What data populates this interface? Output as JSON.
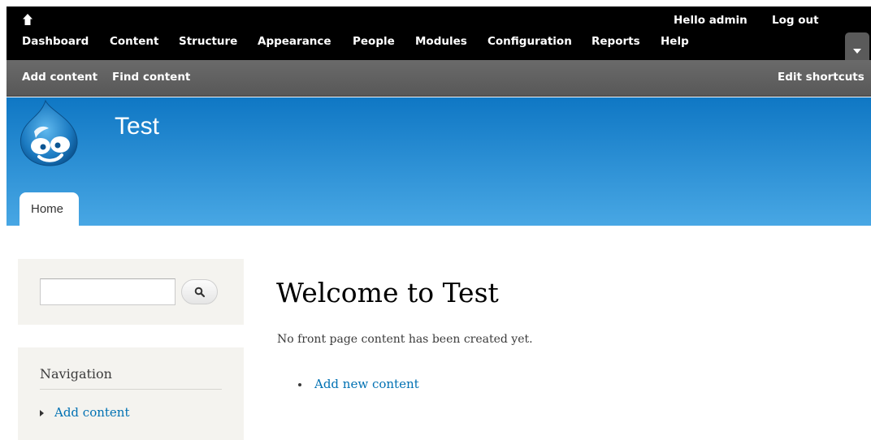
{
  "toolbar": {
    "home_icon": "home-icon",
    "menu": [
      {
        "label": "Dashboard"
      },
      {
        "label": "Content"
      },
      {
        "label": "Structure"
      },
      {
        "label": "Appearance"
      },
      {
        "label": "People"
      },
      {
        "label": "Modules"
      },
      {
        "label": "Configuration"
      },
      {
        "label": "Reports"
      },
      {
        "label": "Help"
      }
    ],
    "greeting": "Hello",
    "username": "admin",
    "logout_label": "Log out",
    "drawer_icon": "caret-down-icon"
  },
  "shortcuts": {
    "items": [
      {
        "label": "Add content"
      },
      {
        "label": "Find content"
      }
    ],
    "edit_label": "Edit shortcuts"
  },
  "header": {
    "logo_icon": "drupal-drop-logo",
    "site_name": "Test",
    "tabs": [
      {
        "label": "Home"
      }
    ]
  },
  "sidebar": {
    "search": {
      "value": "",
      "placeholder": "",
      "button_icon": "search-icon"
    },
    "navigation": {
      "title": "Navigation",
      "items": [
        {
          "label": "Add content"
        }
      ]
    }
  },
  "main": {
    "title": "Welcome to Test",
    "message": "No front page content has been created yet.",
    "links": [
      {
        "label": "Add new content"
      }
    ]
  },
  "colors": {
    "toolbar_bg": "#000000",
    "shortcuts_bg": "#616161",
    "header_gradient_top": "#0f77c4",
    "header_gradient_bottom": "#48a7e4",
    "link": "#0071b3",
    "sidebar_bg": "#f4f3ef"
  }
}
